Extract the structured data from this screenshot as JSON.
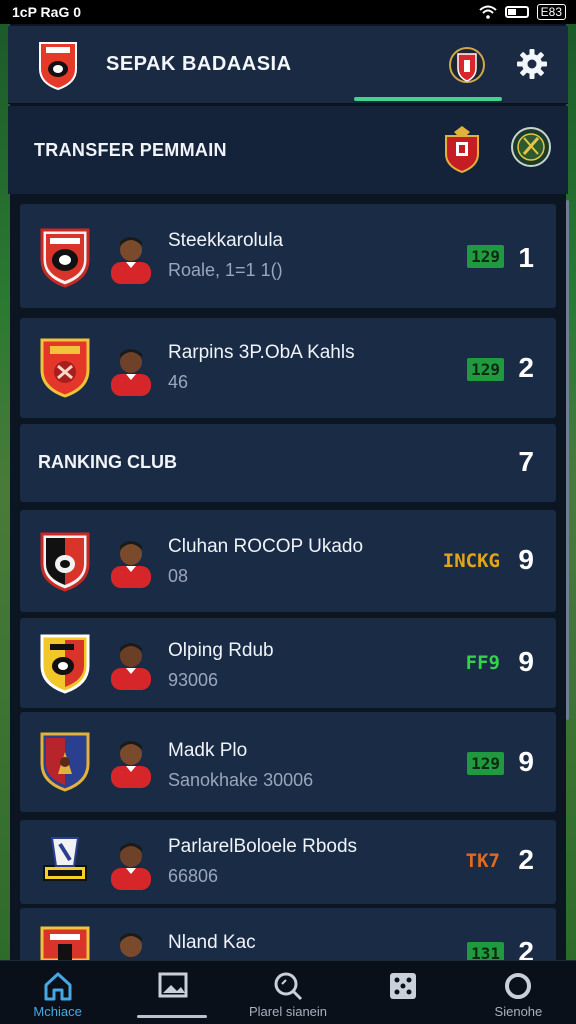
{
  "status_bar": {
    "left_text": "1cP RaG 0",
    "battery_text": "E83"
  },
  "header": {
    "title": "SEPAK BADAASIA",
    "icons": [
      "club-crest-icon",
      "gear-icon"
    ]
  },
  "transfer_section": {
    "title": "TRANSFER PEMMAIN"
  },
  "transfers": [
    {
      "name": "Steekkarolula",
      "sub": "Roale, 1=1 1()",
      "tag": "129",
      "tag_style": "green",
      "number": "1"
    },
    {
      "name": "Rarpins 3P.ObA Kahls",
      "sub": "46",
      "tag": "129",
      "tag_style": "green",
      "number": "2"
    }
  ],
  "ranking_section": {
    "title": "RANKING CLUB",
    "number": "7"
  },
  "rankings": [
    {
      "name": "Cluhan ROCOP Ukado",
      "sub": "08",
      "tag": "INCKG",
      "tag_style": "yellow",
      "number": "9"
    },
    {
      "name": "Olping Rdub",
      "sub": "93006",
      "tag": "FF9",
      "tag_style": "lime",
      "number": "9"
    },
    {
      "name": "Madk Plo",
      "sub": "Sanokhake 30006",
      "tag": "129",
      "tag_style": "green",
      "number": "9"
    },
    {
      "name": "ParlarelBoloele Rbods",
      "sub": "66806",
      "tag": "TK7",
      "tag_style": "orange",
      "number": "2"
    },
    {
      "name": "Nland Kac",
      "sub": "",
      "tag": "131",
      "tag_style": "green",
      "number": "2"
    }
  ],
  "bottom_nav": [
    {
      "label": "Mchiace",
      "icon": "home-icon",
      "active": true
    },
    {
      "label": "",
      "icon": "image-icon",
      "active": false
    },
    {
      "label": "Plarel sianein",
      "icon": "search-icon",
      "active": false
    },
    {
      "label": "",
      "icon": "dice-icon",
      "active": false
    },
    {
      "label": "Sienohe",
      "icon": "circle-icon",
      "active": false
    }
  ],
  "colors": {
    "accent": "#43d38a",
    "nav_active": "#47a9e3",
    "card": "#1a2b45",
    "header": "#1a2a42"
  }
}
